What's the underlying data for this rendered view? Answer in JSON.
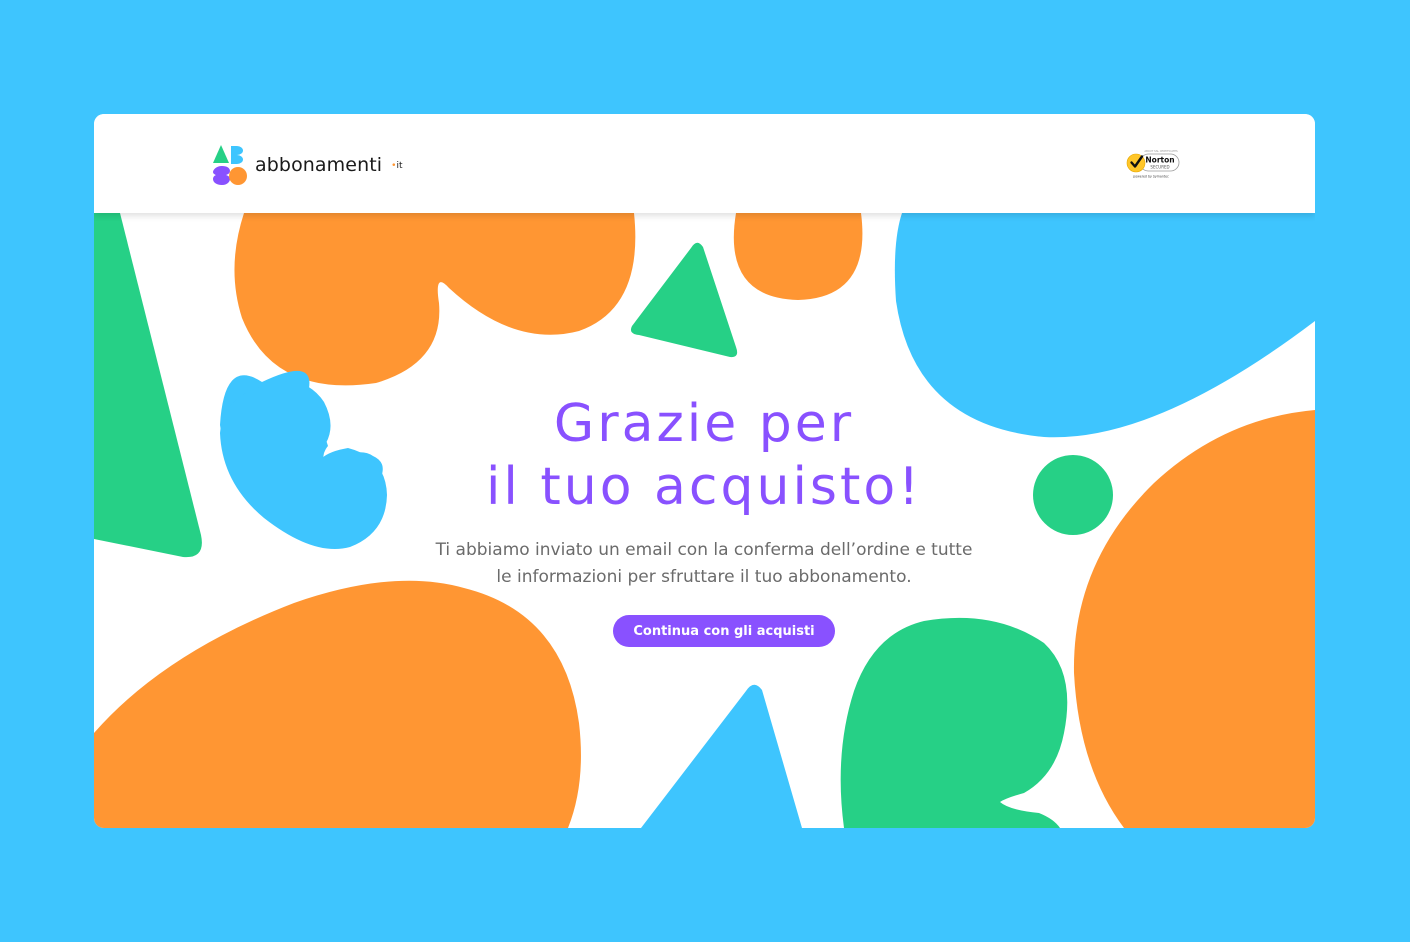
{
  "brand": {
    "name": "abbonamenti",
    "tld_dot": "•",
    "tld": "it",
    "colors": {
      "background": "#3ec5fe",
      "purple": "#8951ff",
      "orange": "#ff9633",
      "green": "#26d086",
      "blue": "#3ec5fe"
    }
  },
  "badge": {
    "top": "ABOUT SSL CERTIFICATES",
    "name": "Norton",
    "secured": "SECURED",
    "powered": "powered by Symantec"
  },
  "main": {
    "title_line1": "Grazie per",
    "title_line2": "il tuo acquisto!",
    "subtitle_line1": "Ti abbiamo inviato un email con la conferma dell’ordine e tutte",
    "subtitle_line2": "le informazioni per sfruttare il tuo abbonamento.",
    "cta_label": "Continua con gli acquisti"
  }
}
